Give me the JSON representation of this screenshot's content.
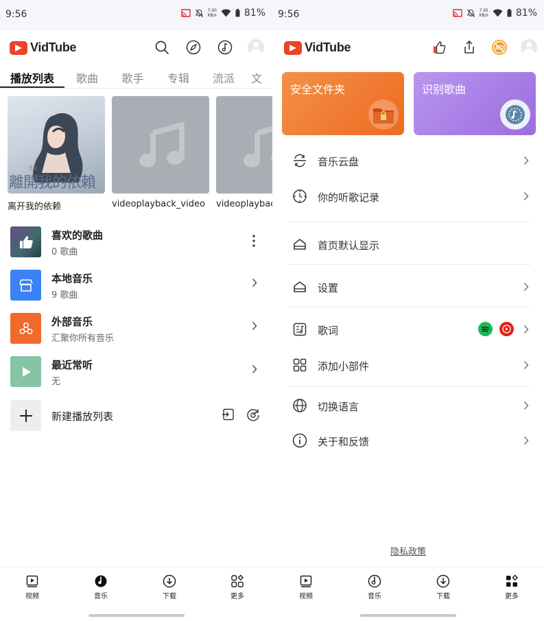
{
  "status": {
    "time": "9:56",
    "battery": "81%",
    "net_speed_left": "7.00",
    "net_speed_right": "7.95",
    "net_unit": "KB/s"
  },
  "brand": {
    "name": "VidTube",
    "color": "#e9432a"
  },
  "left": {
    "tabs": [
      "播放列表",
      "歌曲",
      "歌手",
      "专辑",
      "流派",
      "文"
    ],
    "albums": [
      {
        "title": "离开我的依赖",
        "art_text": "離開我的依賴",
        "art_top": "王葉"
      },
      {
        "title": "videoplayback_video"
      },
      {
        "title": "videoplayback"
      }
    ],
    "playlists": [
      {
        "title": "喜欢的歌曲",
        "sub": "0 歌曲",
        "icon": "thumb-up-icon",
        "action": "more"
      },
      {
        "title": "本地音乐",
        "sub": "9 歌曲",
        "icon": "storefront-icon",
        "action": "chevron"
      },
      {
        "title": "外部音乐",
        "sub": "汇聚你所有音乐",
        "icon": "cluster-icon",
        "action": "chevron"
      },
      {
        "title": "最近常听",
        "sub": "无",
        "icon": "play-icon",
        "action": "chevron"
      }
    ],
    "new_playlist": "新建播放列表"
  },
  "right": {
    "cards": [
      {
        "title": "安全文件夹",
        "color": "#f07b2c"
      },
      {
        "title": "识别歌曲",
        "color": "#a97de8"
      }
    ],
    "menu": [
      {
        "label": "音乐云盘"
      },
      {
        "label": "你的听歌记录"
      },
      {
        "label": "首页默认显示"
      },
      {
        "label": "设置"
      },
      {
        "label": "歌词"
      },
      {
        "label": "添加小部件"
      },
      {
        "label": "切换语言"
      },
      {
        "label": "关于和反馈"
      }
    ],
    "privacy": "隐私政策"
  },
  "nav": [
    {
      "label": "视频",
      "icon": "video-icon"
    },
    {
      "label": "音乐",
      "icon": "music-disc-icon"
    },
    {
      "label": "下载",
      "icon": "download-icon"
    },
    {
      "label": "更多",
      "icon": "grid-more-icon"
    }
  ],
  "colors": {
    "spotify": "#1db954",
    "youtube": "#e62117",
    "local": "#3b82f6",
    "external": "#ef6a2b",
    "recent": "#86c4a6"
  }
}
